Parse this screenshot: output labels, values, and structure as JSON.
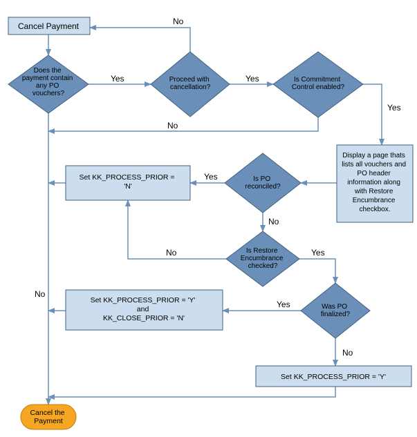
{
  "flow": {
    "start": "Cancel Payment",
    "decision_po_vouchers": "Does the\npayment contain\nany PO\nvouchers?",
    "decision_proceed": "Proceed with\ncancellation?",
    "decision_commitment": "Is Commitment\nControl enabled?",
    "process_display": "Display a page thats\nlists all vouchers and\nPO header\ninformation along\nwith Restore\nEncumbrance\ncheckbox.",
    "decision_reconciled": "Is PO\nreconciled?",
    "process_set_n": "Set KK_PROCESS_PRIOR =\n'N'",
    "decision_restore": "Is Restore\nEncumbrance\nchecked?",
    "decision_finalized": "Was PO\nfinalized?",
    "process_set_y_n": "Set KK_PROCESS_PRIOR = 'Y'\nand\nKK_CLOSE_PRIOR = 'N'",
    "process_set_y": "Set KK_PROCESS_PRIOR = 'Y'",
    "terminator": "Cancel the\nPayment"
  },
  "labels": {
    "yes": "Yes",
    "no": "No"
  },
  "colors": {
    "diamond_fill": "#6a8fb8",
    "diamond_stroke": "#43607f",
    "box_fill": "#cbddee",
    "box_stroke": "#43607f",
    "terminator_fill": "#f5a623",
    "terminator_stroke": "#c47b00",
    "arrow": "#6a8fb8",
    "text": "#000000",
    "bg": "#ffffff"
  }
}
